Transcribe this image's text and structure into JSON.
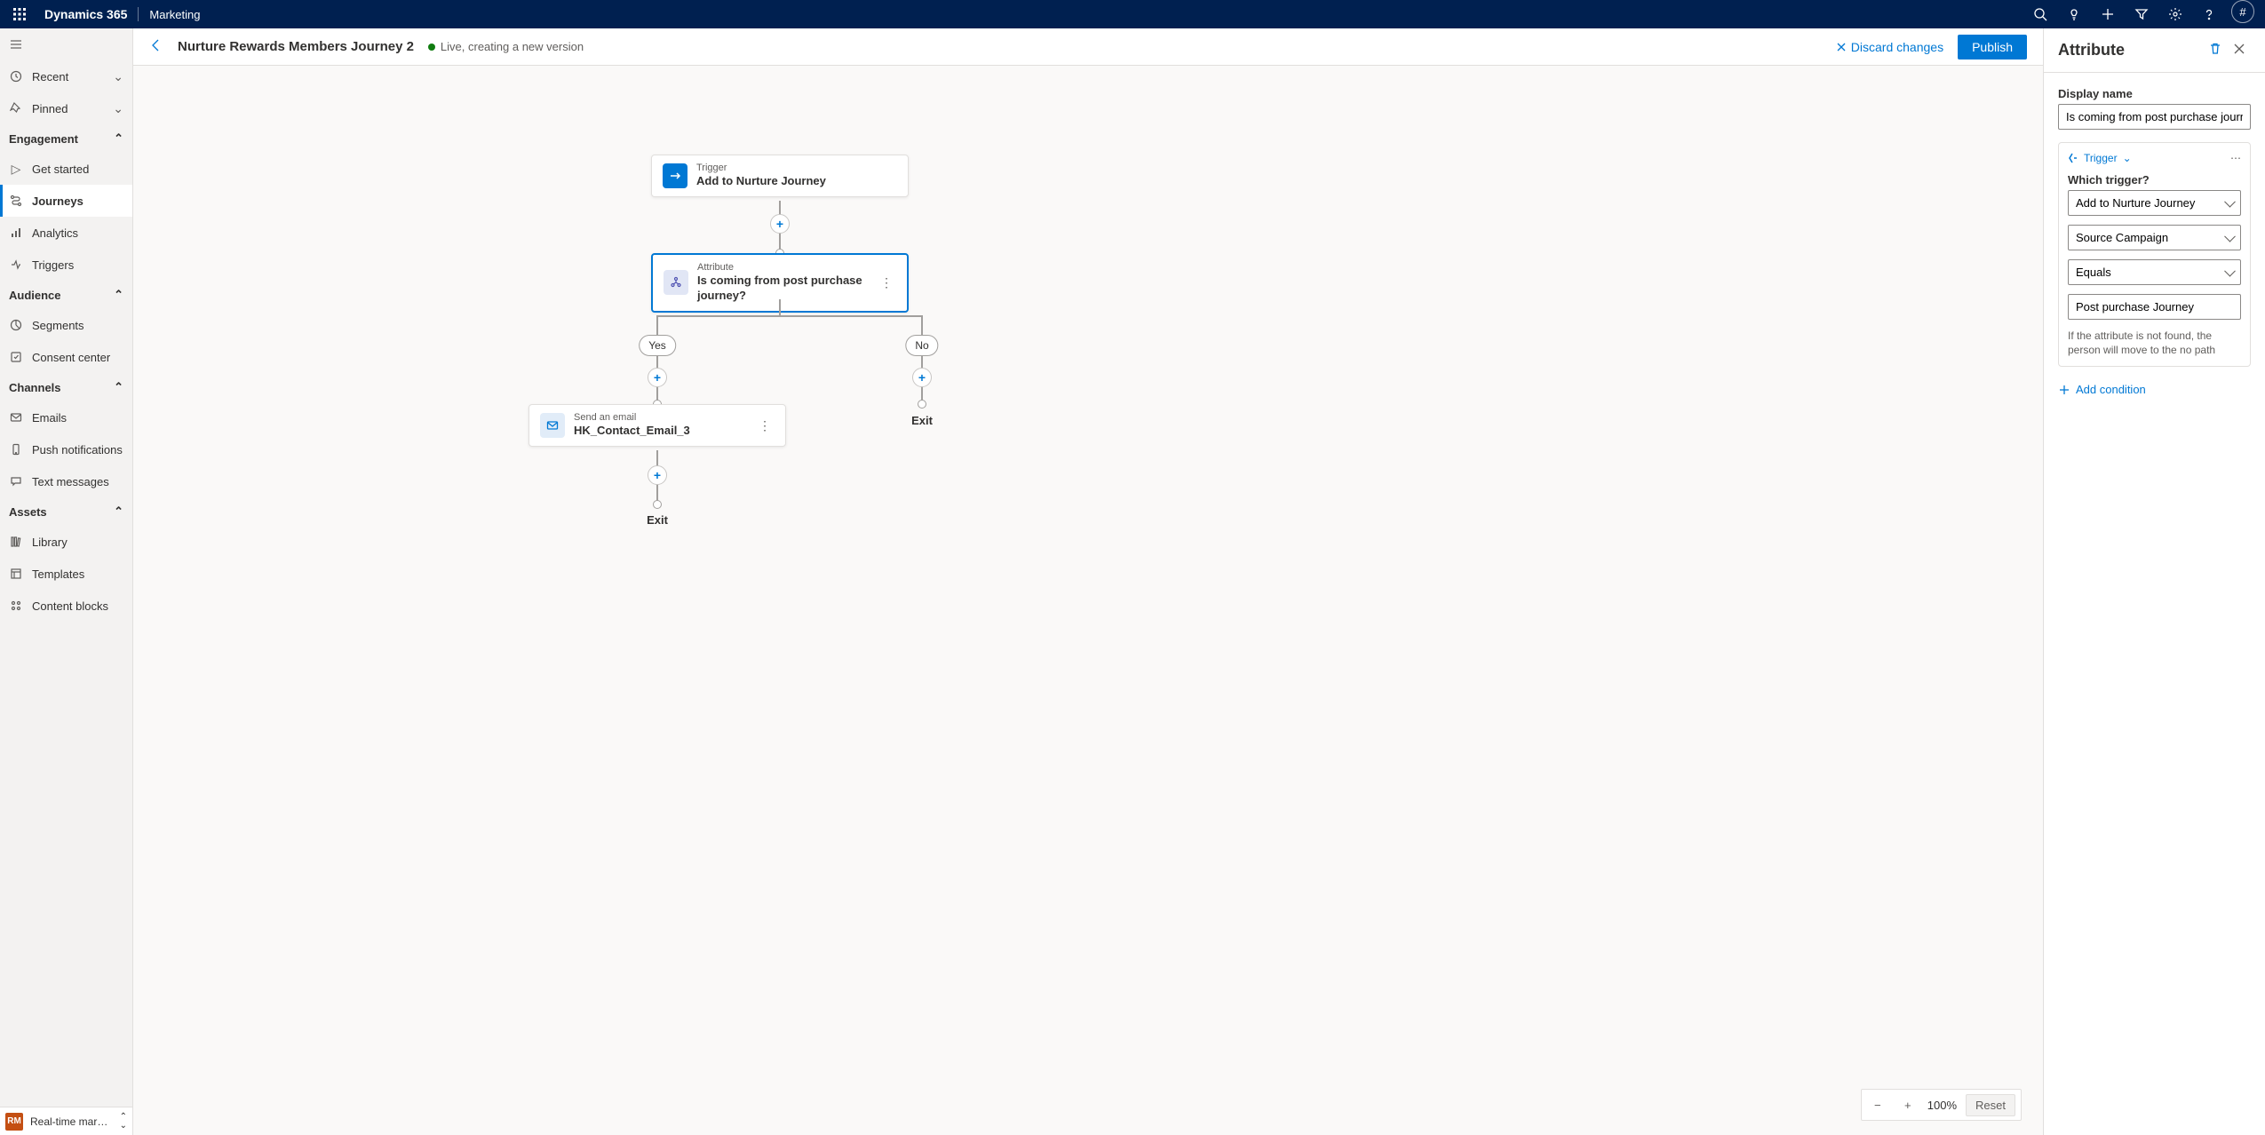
{
  "topbar": {
    "brand": "Dynamics 365",
    "module": "Marketing",
    "account": "#"
  },
  "sidebar": {
    "recent": "Recent",
    "pinned": "Pinned",
    "groupEngagement": "Engagement",
    "getStarted": "Get started",
    "journeys": "Journeys",
    "analytics": "Analytics",
    "triggers": "Triggers",
    "groupAudience": "Audience",
    "segments": "Segments",
    "consent": "Consent center",
    "groupChannels": "Channels",
    "emails": "Emails",
    "push": "Push notifications",
    "sms": "Text messages",
    "groupAssets": "Assets",
    "library": "Library",
    "templates": "Templates",
    "blocks": "Content blocks",
    "areaBadge": "RM",
    "areaLabel": "Real-time marketi…"
  },
  "header": {
    "title": "Nurture Rewards Members Journey 2",
    "status": "Live, creating a new version",
    "discard": "Discard changes",
    "publish": "Publish"
  },
  "canvas": {
    "trigger_sup": "Trigger",
    "trigger_sub": "Add to Nurture Journey",
    "attr_sup": "Attribute",
    "attr_sub": "Is coming from post purchase journey?",
    "yes": "Yes",
    "no": "No",
    "email_sup": "Send an email",
    "email_sub": "HK_Contact_Email_3",
    "exit": "Exit",
    "zoom_pct": "100%",
    "reset": "Reset"
  },
  "props": {
    "title": "Attribute",
    "displayName_lbl": "Display name",
    "displayName_val": "Is coming from post purchase journey?",
    "cond_type": "Trigger",
    "which_trigger_lbl": "Which trigger?",
    "which_trigger_val": "Add to Nurture Journey",
    "field_val": "Source Campaign",
    "op_val": "Equals",
    "value_val": "Post purchase Journey",
    "note": "If the attribute is not found, the person will move to the no path",
    "add_condition": "Add condition"
  }
}
